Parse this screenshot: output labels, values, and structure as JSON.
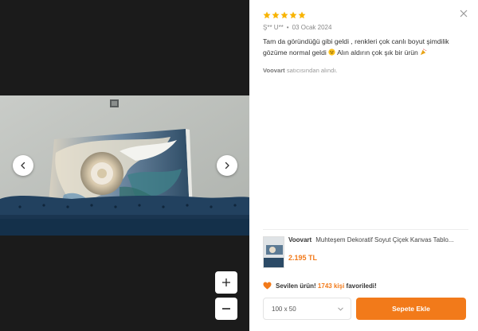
{
  "review": {
    "rating": 5,
    "reviewer": "Ş** U**",
    "date": "03 Ocak 2024",
    "text_part1": "Tam da göründüğü gibi geldi , renkleri çok canlı boyut şimdilik gözüme normal geldi",
    "text_part2": "Alın aldırın çok şık bir ürün",
    "seller_name": "Voovart",
    "seller_suffix": "satıcısından alındı."
  },
  "product": {
    "brand": "Voovart",
    "name": "Muhteşem Dekoratif Soyut Çiçek Kanvas Tablo...",
    "price": "2.195 TL"
  },
  "favorite": {
    "label": "Sevilen ürün!",
    "count": "1743 kişi",
    "suffix": "favoriledi!"
  },
  "size_select": {
    "value": "100 x 50"
  },
  "cart_button": {
    "label": "Sepete Ekle"
  },
  "icons": {
    "close": "close-icon",
    "prev": "chevron-left-icon",
    "next": "chevron-right-icon",
    "zoom_in": "plus-icon",
    "zoom_out": "minus-icon",
    "heart": "heart-icon",
    "dropdown": "chevron-down-icon"
  },
  "colors": {
    "accent": "#f27a1a",
    "star": "#f8b400",
    "viewer_bg": "#1b1b1b"
  }
}
